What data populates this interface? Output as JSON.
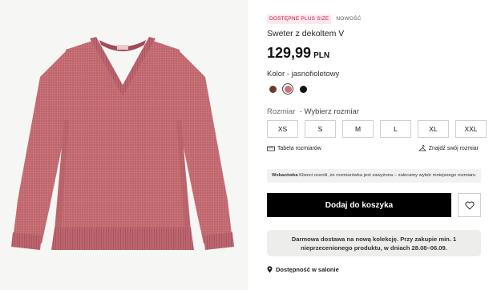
{
  "product": {
    "badge_plus": "DOSTĘPNE PLUS SIZE",
    "badge_new": "NOWOŚĆ",
    "title": "Sweter z dekoltem V",
    "price": "129,99",
    "currency": "PLN",
    "image_alt_icon": "sweater-image"
  },
  "color": {
    "label": "Kolor - jasnofioletowy",
    "swatches": [
      {
        "name": "brown",
        "hex": "#6b3a2c",
        "selected": false
      },
      {
        "name": "jasnofioletowy",
        "hex": "#c9727b",
        "selected": true
      },
      {
        "name": "black",
        "hex": "#111111",
        "selected": false
      }
    ]
  },
  "size": {
    "label": "Rozmiar",
    "placeholder": "Wybierz rozmiar",
    "options": [
      "XS",
      "S",
      "M",
      "L",
      "XL",
      "XXL"
    ],
    "size_table_link": "Tabela rozmiarów",
    "find_size_link": "Znajdź swój rozmiar"
  },
  "hint": {
    "bold": "Wskazówka",
    "text": "Klienci ocenili, że rozmiarówka jest zawyżona – zalecamy wybór mniejszego rozmiaru"
  },
  "actions": {
    "add_to_cart": "Dodaj do koszyka"
  },
  "shipping": {
    "line1": "Darmowa dostawa na nową kolekcję. Przy zakupie min. 1",
    "line2": "nieprzecenionego produktu, w dniach 28.08–06.09."
  },
  "store": {
    "label": "Dostępność w salonie"
  },
  "colors": {
    "sweater": "#c46b72",
    "badge_red": "#c21a4a",
    "button_black": "#000000"
  }
}
